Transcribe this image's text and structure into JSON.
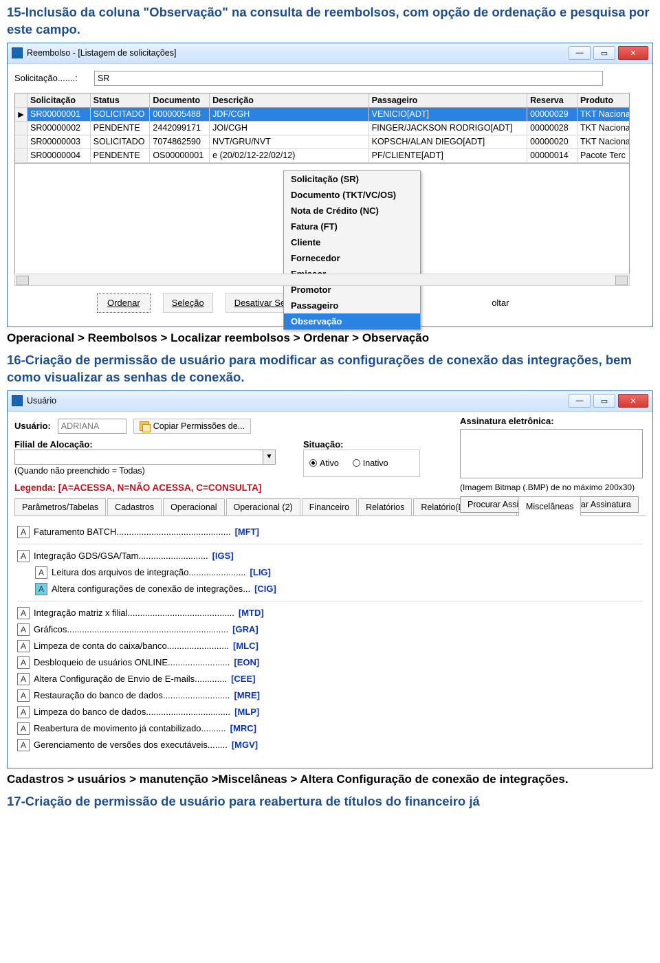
{
  "doc": {
    "title15": "15-Inclusão da coluna \"Observação\" na consulta de reembolsos, com opção de ordenação e pesquisa por este campo.",
    "path15": "Operacional > Reembolsos > Localizar reembolsos > Ordenar > Observação",
    "title16": "16-Criação de permissão de usuário para modificar as configurações de conexão das integrações, bem como visualizar as senhas de conexão.",
    "path16a": "Cadastros > usuários > manutenção >Miscelâneas > Altera Configuração de conexão de integrações.",
    "title17": "17-Criação de permissão de usuário para reabertura de títulos do financeiro já"
  },
  "win1": {
    "title": "Reembolso - [Listagem de solicitações]",
    "solic_label": "Solicitação.......:",
    "solic_value": "SR",
    "columns": [
      "Solicitação",
      "Status",
      "Documento",
      "Descrição",
      "Passageiro",
      "Reserva",
      "Produto"
    ],
    "rows": [
      {
        "sol": "SR00000001",
        "stat": "SOLICITADO",
        "doc": "0000005488",
        "desc": "JDF/CGH",
        "pass": "VENICIO[ADT]",
        "res": "00000029",
        "prod": "TKT Naciona"
      },
      {
        "sol": "SR00000002",
        "stat": "PENDENTE",
        "doc": "2442099171",
        "desc": "JOI/CGH",
        "pass": "FINGER/JACKSON RODRIGO[ADT]",
        "res": "00000028",
        "prod": "TKT Naciona"
      },
      {
        "sol": "SR00000003",
        "stat": "SOLICITADO",
        "doc": "7074862590",
        "desc": "NVT/GRU/NVT",
        "pass": "KOPSCH/ALAN DIEGO[ADT]",
        "res": "00000020",
        "prod": "TKT Naciona"
      },
      {
        "sol": "SR00000004",
        "stat": "PENDENTE",
        "doc": "OS00000001",
        "desc": "e (20/02/12-22/02/12)",
        "pass": "PF/CLIENTE[ADT]",
        "res": "00000014",
        "prod": "Pacote Terc"
      }
    ],
    "menu": [
      "Solicitação (SR)",
      "Documento (TKT/VC/OS)",
      "Nota de Crédito (NC)",
      "Fatura (FT)",
      "Cliente",
      "Fornecedor",
      "Emissor",
      "Promotor",
      "Passageiro",
      "Observação"
    ],
    "buttons": {
      "ordenar": "Ordenar",
      "selecao": "Seleção",
      "desativar": "Desativar Seleção",
      "oltar": "oltar"
    }
  },
  "win2": {
    "title": "Usuário",
    "usuario_label": "Usuário:",
    "usuario_value": "ADRIANA",
    "copy_btn": "Copiar Permissões de...",
    "filial_label": "Filial de Alocação:",
    "quando_label": "(Quando não preenchido = Todas)",
    "situacao_label": "Situação:",
    "ativo": "Ativo",
    "inativo": "Inativo",
    "assinatura_label": "Assinatura eletrônica:",
    "bmp_note": "(Imagem Bitmap (.BMP) de no máximo 200x30)",
    "procurar_btn": "Procurar Assinatura",
    "limpar_btn": "Limpar Assinatura",
    "legend": "Legenda: [A=ACESSA, N=NÃO ACESSA, C=CONSULTA]",
    "tabs": [
      "Parâmetros/Tabelas",
      "Cadastros",
      "Operacional",
      "Operacional (2)",
      "Financeiro",
      "Relatórios",
      "Relatório(Documentos)",
      "Miscelâneas"
    ],
    "perms": [
      {
        "flag": "A",
        "text": "Faturamento BATCH..............................................",
        "code": "[MFT]",
        "indent": false
      },
      {
        "flag": "A",
        "text": "Integração GDS/GSA/Tam............................",
        "code": "[IGS]",
        "indent": false
      },
      {
        "flag": "A",
        "text": "Leitura dos arquivos de integração.......................",
        "code": "[LIG]",
        "indent": true
      },
      {
        "flag": "A",
        "text": "Altera configurações de conexão de integrações...",
        "code": "[CIG]",
        "indent": true,
        "hi": true
      },
      {
        "flag": "A",
        "text": "Integração matriz x filial...........................................",
        "code": "[MTD]",
        "indent": false
      },
      {
        "flag": "A",
        "text": "Gráficos.................................................................",
        "code": "[GRA]",
        "indent": false
      },
      {
        "flag": "A",
        "text": "Limpeza de conta do caixa/banco.........................",
        "code": "[MLC]",
        "indent": false
      },
      {
        "flag": "A",
        "text": "Desbloqueio de usuários ONLINE.........................",
        "code": "[EON]",
        "indent": false
      },
      {
        "flag": "A",
        "text": "Altera Configuração de Envio de E-mails.............",
        "code": "[CEE]",
        "indent": false
      },
      {
        "flag": "A",
        "text": "Restauração do banco de dados...........................",
        "code": "[MRE]",
        "indent": false
      },
      {
        "flag": "A",
        "text": "Limpeza do banco de dados..................................",
        "code": "[MLP]",
        "indent": false
      },
      {
        "flag": "A",
        "text": "Reabertura de movimento já contabilizado..........",
        "code": "[MRC]",
        "indent": false
      },
      {
        "flag": "A",
        "text": "Gerenciamento de versões dos executáveis........",
        "code": "[MGV]",
        "indent": false
      }
    ]
  }
}
